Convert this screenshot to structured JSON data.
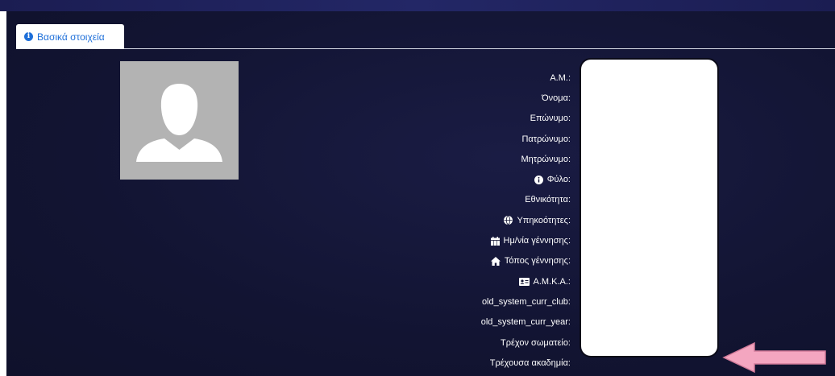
{
  "tabs": [
    {
      "label": "Βασικά στοιχεία",
      "icon": "info-circle-icon"
    }
  ],
  "fields": [
    {
      "label": "Α.Μ.:",
      "icon": null
    },
    {
      "label": "Όνομα:",
      "icon": null
    },
    {
      "label": "Επώνυμο:",
      "icon": null
    },
    {
      "label": "Πατρώνυμο:",
      "icon": null
    },
    {
      "label": "Μητρώνυμο:",
      "icon": null
    },
    {
      "label": "Φύλο:",
      "icon": "info-circle-icon"
    },
    {
      "label": "Εθνικότητα:",
      "icon": null
    },
    {
      "label": "Υπηκοότητες:",
      "icon": "globe-icon"
    },
    {
      "label": "Ημ/νία γέννησης:",
      "icon": "calendar-icon"
    },
    {
      "label": "Τόπος γέννησης:",
      "icon": "home-icon"
    },
    {
      "label": "Α.Μ.Κ.Α.:",
      "icon": "id-card-icon"
    },
    {
      "label": "old_system_curr_club:",
      "icon": null
    },
    {
      "label": "old_system_curr_year:",
      "icon": null
    },
    {
      "label": "Τρέχον σωματείο:",
      "icon": null
    },
    {
      "label": "Τρέχουσα ακαδημία:",
      "icon": null
    }
  ],
  "colors": {
    "background": "#121432",
    "accent": "#1e6fd9",
    "avatar": "#b3b3b3",
    "arrow": "#f4a6c0"
  }
}
